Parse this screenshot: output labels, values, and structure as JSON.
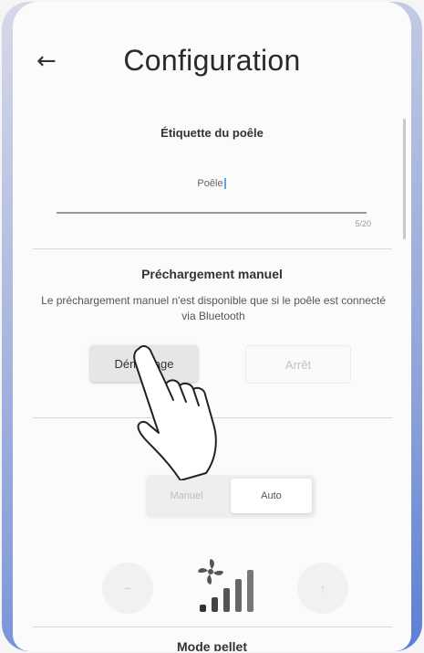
{
  "header": {
    "back_icon": "arrow-left-icon",
    "title": "Configuration"
  },
  "stove": {
    "section_label": "Étiquette du poêle",
    "name_value": "Poêle",
    "char_counter": "5/20"
  },
  "manual_preload": {
    "title": "Préchargement manuel",
    "description": "Le préchargement manuel n'est disponible que si le poêle est connecté via Bluetooth",
    "start_label": "Démarrage",
    "stop_label": "Arrêt"
  },
  "mode_toggle": {
    "manual_label": "Manuel",
    "auto_label": "Auto",
    "selected": "Auto"
  },
  "fan_control": {
    "minus_label": "−",
    "plus_label": "↑",
    "icon": "fan-speed-icon"
  },
  "next_section": {
    "title": "Mode pellet"
  },
  "overlay": {
    "gesture_icon": "tap-hand-icon"
  },
  "colors": {
    "accent": "#5fa6e6",
    "divider": "#d8d8d8",
    "frame_blue": "#5b7fd6"
  }
}
